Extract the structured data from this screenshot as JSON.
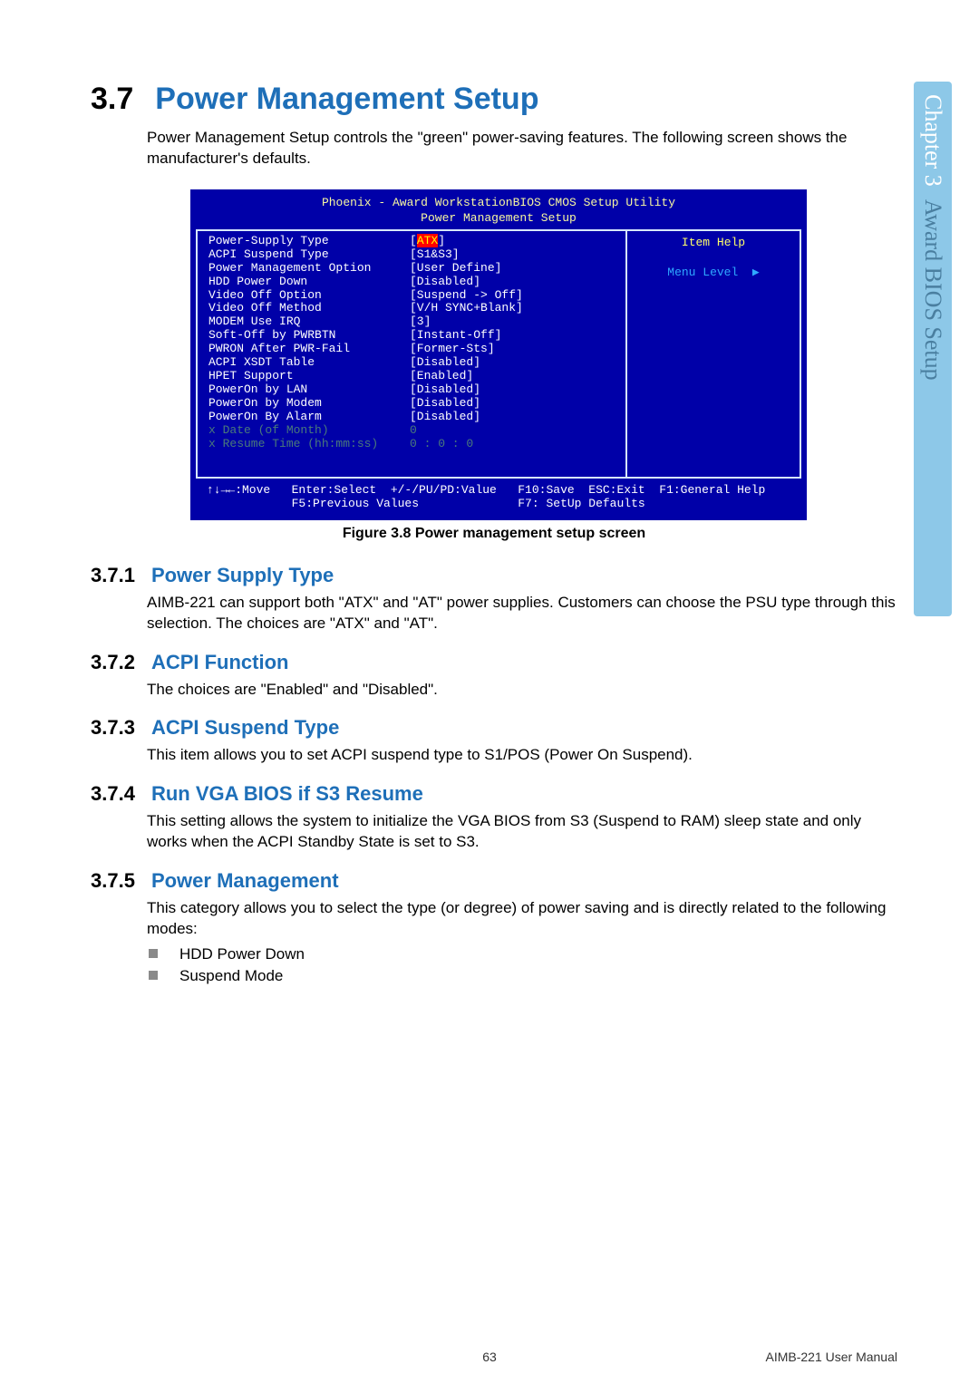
{
  "sidebar": {
    "chapter": "Chapter 3",
    "title": "Award BIOS Setup"
  },
  "section": {
    "number": "3.7",
    "title": "Power Management Setup",
    "intro": "Power Management Setup controls the \"green\" power-saving features. The following screen shows the manufacturer's defaults."
  },
  "bios": {
    "title_line1": "Phoenix - Award WorkstationBIOS CMOS Setup Utility",
    "title_line2": "Power Management Setup",
    "rows": [
      {
        "label": "Power-Supply Type",
        "value_prefix": "[",
        "value_hl": "ATX",
        "value_suffix": "]"
      },
      {
        "label": "ACPI Suspend Type",
        "value": "[S1&S3]"
      },
      {
        "label": "Power Management Option",
        "value": "[User Define]"
      },
      {
        "label": "HDD Power Down",
        "value": "[Disabled]"
      },
      {
        "label": "Video Off Option",
        "value": "[Suspend -> Off]"
      },
      {
        "label": "Video Off Method",
        "value": "[V/H SYNC+Blank]"
      },
      {
        "label": "MODEM Use IRQ",
        "value": "[3]"
      },
      {
        "label": "Soft-Off by PWRBTN",
        "value": "[Instant-Off]"
      },
      {
        "label": "PWRON After PWR-Fail",
        "value": "[Former-Sts]"
      },
      {
        "label": "ACPI XSDT Table",
        "value": "[Disabled]"
      },
      {
        "label": "HPET Support",
        "value": "[Enabled]"
      },
      {
        "label": "PowerOn by LAN",
        "value": "[Disabled]"
      },
      {
        "label": "PowerOn by Modem",
        "value": "[Disabled]"
      },
      {
        "label": "PowerOn By Alarm",
        "value": "[Disabled]"
      },
      {
        "label": "x Date (of Month)",
        "value": "  0",
        "dim": true
      },
      {
        "label": "x Resume Time (hh:mm:ss)",
        "value": "  0 :  0 :  0",
        "dim": true
      }
    ],
    "help_title": "Item Help",
    "menu_level": "Menu Level",
    "footer_line1": "↑↓→←:Move   Enter:Select  +/-/PU/PD:Value   F10:Save  ESC:Exit  F1:General Help",
    "footer_line2": "            F5:Previous Values              F7: SetUp Defaults"
  },
  "figure_caption": "Figure 3.8 Power management setup screen",
  "subs": {
    "s371": {
      "num": "3.7.1",
      "title": "Power Supply Type",
      "body": "AIMB-221 can support both \"ATX\" and \"AT\" power supplies. Customers can choose the PSU type through this selection. The choices are \"ATX\" and \"AT\"."
    },
    "s372": {
      "num": "3.7.2",
      "title": "ACPI Function",
      "body": "The choices are \"Enabled\" and \"Disabled\"."
    },
    "s373": {
      "num": "3.7.3",
      "title": "ACPI Suspend Type",
      "body": "This item allows you to set ACPI suspend type to S1/POS (Power On Suspend)."
    },
    "s374": {
      "num": "3.7.4",
      "title": "Run VGA BIOS if S3 Resume",
      "body": "This setting allows the system to initialize the VGA BIOS from S3 (Suspend to RAM) sleep state and only works when the ACPI Standby State is set to S3."
    },
    "s375": {
      "num": "3.7.5",
      "title": "Power Management",
      "body": "This category allows you to select the type (or degree) of power saving and is directly related to the following modes:",
      "bullets": [
        "HDD Power Down",
        "Suspend Mode"
      ]
    }
  },
  "footer": {
    "page": "63",
    "manual": "AIMB-221 User Manual"
  }
}
